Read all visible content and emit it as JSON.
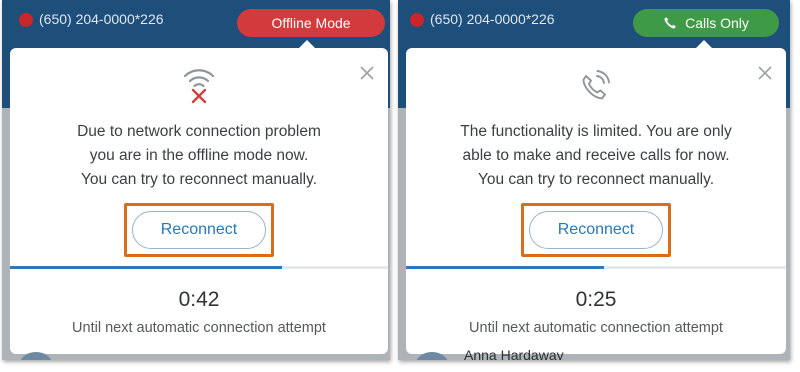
{
  "left_panel": {
    "phone_number": "(650) 204-0000*226",
    "mode_label": "Offline Mode",
    "mode_icon": "none",
    "card_icon": "wifi-x-icon",
    "message_lines": [
      "Due to network connection problem",
      "you are in the offline mode now.",
      "You can try to reconnect manually."
    ],
    "reconnect_label": "Reconnect",
    "progress": 0.72,
    "countdown": "0:42",
    "countdown_caption": "Until next automatic connection attempt"
  },
  "right_panel": {
    "phone_number": "(650) 204-0000*226",
    "mode_label": "Calls Only",
    "mode_icon": "phone-icon",
    "card_icon": "phone-ringing-icon",
    "message_lines": [
      "The functionality is limited. You are only",
      "able to make and receive calls for now.",
      "You can try to reconnect manually."
    ],
    "reconnect_label": "Reconnect",
    "progress": 0.52,
    "countdown": "0:25",
    "countdown_caption": "Until next automatic connection attempt",
    "contact_name": "Anna Hardaway"
  },
  "colors": {
    "header_bg": "#1e4e7a",
    "status_red": "#c8262a",
    "offline_pill": "#d23a3d",
    "calls_pill": "#3f9a48",
    "accent_blue": "#2979b8",
    "highlight_orange": "#d66e1d"
  }
}
